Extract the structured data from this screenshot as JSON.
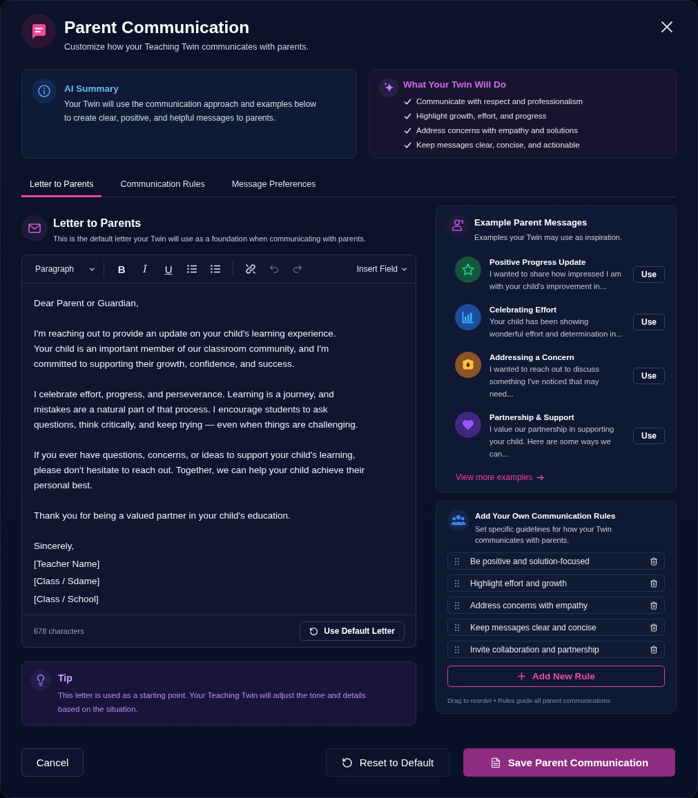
{
  "dialog": {
    "title": "Parent Communication",
    "subtitle": "Customize how your Teaching Twin communicates with parents."
  },
  "summary": {
    "title": "AI Summary",
    "text": "Your Twin will use the communication approach and examples below to create clear, positive, and helpful messages to parents."
  },
  "twin_actions": {
    "title": "What Your Twin Will Do",
    "items": [
      "Communicate with respect and professionalism",
      "Highlight growth, effort, and progress",
      "Address concerns with empathy and solutions",
      "Keep messages clear, concise, and actionable"
    ]
  },
  "tabs": [
    {
      "label": "Letter to Parents",
      "selected": true
    },
    {
      "label": "Communication Rules",
      "selected": false
    },
    {
      "label": "Message Preferences",
      "selected": false
    }
  ],
  "letter": {
    "title": "Letter to Parents",
    "description": "This is the default letter your Twin will use as a foundation when communicating with parents.",
    "toolbar": {
      "block_format": "Paragraph",
      "tool_groups": [
        [
          {
            "kind": "bold",
            "label": "B",
            "disabled": false
          },
          {
            "kind": "italic",
            "label": "I",
            "disabled": false
          },
          {
            "kind": "underline",
            "label": "U",
            "disabled": false
          },
          {
            "kind": "list",
            "disabled": false
          },
          {
            "kind": "list",
            "disabled": false
          }
        ],
        [
          {
            "kind": "link",
            "disabled": false
          },
          {
            "kind": "undo",
            "disabled": true
          },
          {
            "kind": "redo",
            "disabled": true
          }
        ]
      ],
      "insert_menu": "Insert Field"
    },
    "paragraphs": [
      [
        "Dear Parent or Guardian,"
      ],
      [
        "I'm reaching out to provide an update on your child's learning experience.",
        "Your child is an important member of our classroom community, and I'm committed to supporting their growth, confidence, and success."
      ],
      [
        "I celebrate effort, progress, and perseverance. Learning is a journey, and mistakes are a natural part of that process. I encourage students to ask questions, think critically, and keep trying — even when things are challenging."
      ],
      [
        "If you ever have questions, concerns, or ideas to support your child's learning, please don't hesitate to reach out. Together, we can help your child achieve their personal best."
      ],
      [
        "Thank you for being a valued partner in your child's education."
      ]
    ],
    "signature": [
      "Sincerely,",
      "[Teacher Name]",
      "[Class / Sdame]",
      "[Class / School]"
    ],
    "character_count": "678 characters",
    "default_button": "Use Default Letter"
  },
  "tip": {
    "title": "Tip",
    "text": "This letter is used as a starting point. Your Teaching Twin will adjust the tone and details based on the situation."
  },
  "examples": {
    "title": "Example Parent Messages",
    "subtitle": "Examples your Twin may use as inspiration.",
    "items": [
      {
        "title": "Positive Progress Update",
        "preview": "I wanted to share how impressed I am with your child's improvement in...",
        "color": "#15553c",
        "button": "Use"
      },
      {
        "title": "Celebrating Effort",
        "preview": "Your child has been showing wonderful effort and determination in...",
        "color": "#1f4d9e",
        "button": "Use"
      },
      {
        "title": "Addressing a Concern",
        "preview": "I wanted to reach out to discuss something I've noticed that may need...",
        "color": "#8b5425",
        "button": "Use"
      },
      {
        "title": "Partnership & Support",
        "preview": "I value our partnership in supporting your child. Here are some ways we can...",
        "color": "#3f2880",
        "button": "Use"
      }
    ],
    "more_link": "View more examples"
  },
  "rules": {
    "title": "Add Your Own Communication Rules",
    "subtitle": "Set specific guidelines for how your Twin communicates with parents.",
    "items": [
      "Be positive and solution-focused",
      "Highlight effort and growth",
      "Address concerns with empathy",
      "Keep messages clear and concise",
      "Invite collaboration and partnership"
    ],
    "add_button": "Add New Rule",
    "footnote": "Drag to reorder • Rules guide all parent communications"
  },
  "actions": {
    "cancel": "Cancel",
    "reset": "Reset to Default",
    "save": "Save Parent Communication"
  }
}
